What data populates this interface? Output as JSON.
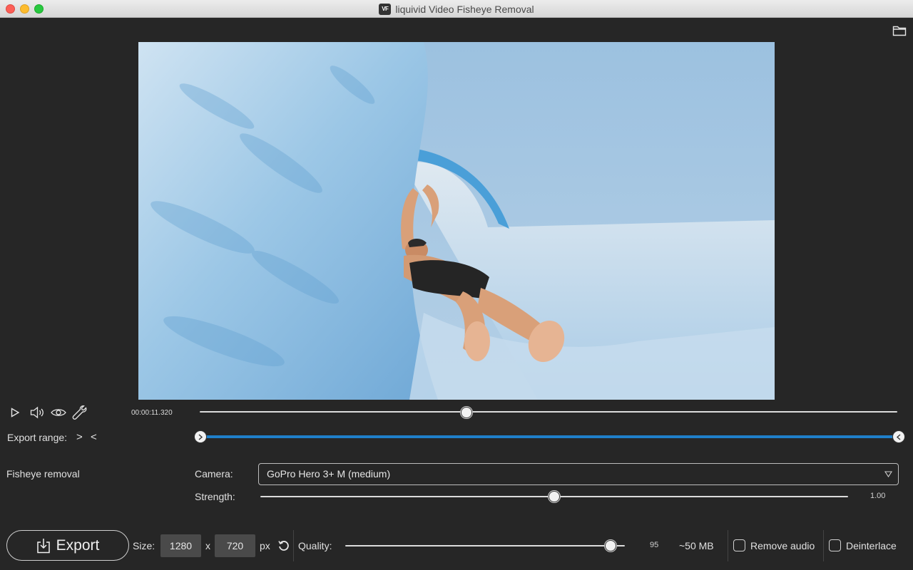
{
  "window": {
    "title": "liquivid Video Fisheye Removal",
    "app_icon_text": "VF"
  },
  "icons": {
    "open_folder": "folder-icon",
    "play": "play-icon",
    "volume": "speaker-icon",
    "preview": "eye-icon",
    "settings": "wrench-icon",
    "export": "download-icon",
    "reset_size": "reset-icon",
    "dropdown": "chevron-down-icon"
  },
  "player": {
    "timecode": "00:00:11.320",
    "playhead_fraction": 0.382
  },
  "export_range": {
    "label": "Export range:",
    "set_start_glyph": ">",
    "set_end_glyph": "<",
    "start_fraction": 0.0,
    "end_fraction": 1.0
  },
  "fisheye": {
    "section_label": "Fisheye removal",
    "camera_label": "Camera:",
    "camera_value": "GoPro Hero 3+ M (medium)",
    "strength_label": "Strength:",
    "strength_value": "1.00",
    "strength_fraction": 0.5
  },
  "export": {
    "button_label": "Export",
    "size_label": "Size:",
    "width": "1280",
    "x_label": "x",
    "height": "720",
    "unit_label": "px",
    "quality_label": "Quality:",
    "quality_value": "95",
    "quality_fraction": 0.95,
    "estimated_size": "~50 MB",
    "remove_audio_label": "Remove audio",
    "remove_audio_checked": false,
    "deinterlace_label": "Deinterlace",
    "deinterlace_checked": false
  },
  "colors": {
    "accent": "#1f7fc9",
    "background": "#262626"
  }
}
